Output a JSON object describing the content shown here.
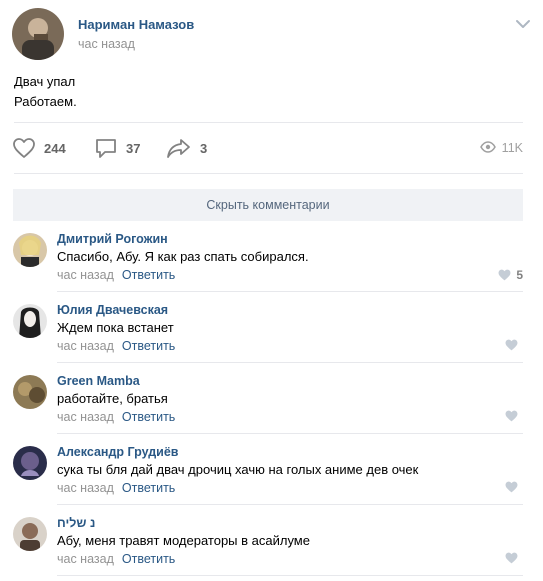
{
  "post": {
    "author": "Нариман Намазов",
    "time": "час назад",
    "text_line1": "Двач упал",
    "text_line2": "Работаем.",
    "likes": "244",
    "comments": "37",
    "shares": "3",
    "views": "11K"
  },
  "hide_comments_label": "Скрыть комментарии",
  "comments": [
    {
      "author": "Дмитрий Рогожин",
      "text": "Спасибо, Абу. Я как раз спать собирался.",
      "time": "час назад",
      "reply": "Ответить",
      "likes": "5"
    },
    {
      "author": "Юлия Двачевская",
      "text": "Ждем пока встанет",
      "time": "час назад",
      "reply": "Ответить",
      "likes": ""
    },
    {
      "author": "Green Mamba",
      "text": "работайте, братья",
      "time": "час назад",
      "reply": "Ответить",
      "likes": ""
    },
    {
      "author": "Александр Грудиёв",
      "text": "сука ты бля дай двач дрочиц хачю на голых аниме дев очек",
      "time": "час назад",
      "reply": "Ответить",
      "likes": ""
    },
    {
      "author": "נ שליח",
      "text": "Абу, меня травят модераторы в асайлуме",
      "time": "час назад",
      "reply": "Ответить",
      "likes": ""
    }
  ],
  "colors": {
    "link": "#2a5885",
    "muted": "#939393",
    "icon": "#828282",
    "button_bg": "#f0f2f5"
  },
  "icons": [
    "chevron-down-icon",
    "heart-icon",
    "comment-icon",
    "share-icon",
    "eye-icon"
  ]
}
